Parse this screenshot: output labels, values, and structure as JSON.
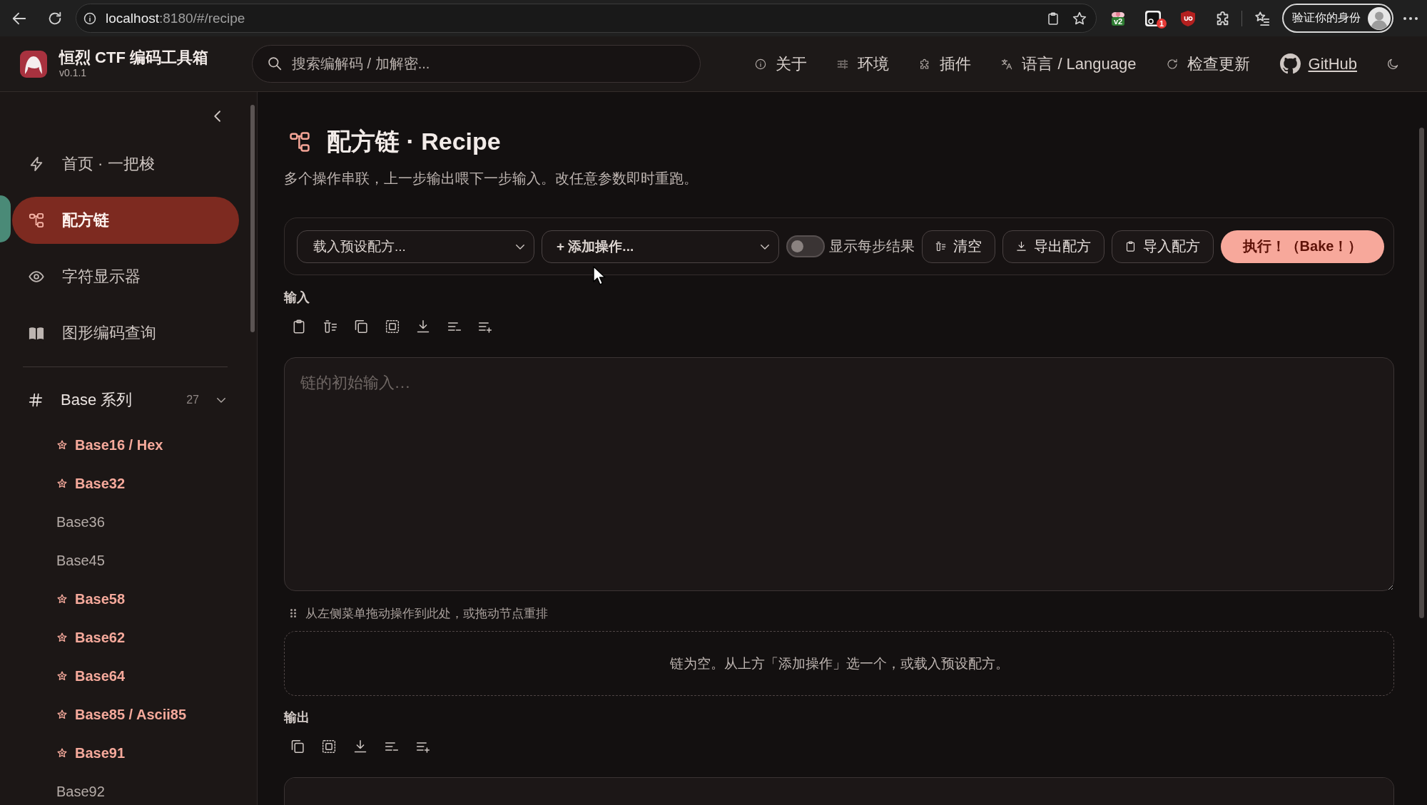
{
  "browser": {
    "url": {
      "host": "localhost",
      "path": ":8180/#/recipe"
    },
    "extensions": [
      {
        "kind": "label",
        "text": "v2"
      },
      {
        "kind": "badge",
        "text": "1"
      },
      {
        "kind": "shield"
      },
      {
        "kind": "puzzle"
      }
    ],
    "profile_button": "验证你的身份"
  },
  "header": {
    "title": "恒烈 CTF 编码工具箱",
    "version": "v0.1.1",
    "search": {
      "placeholder": "搜索编解码 / 加解密..."
    },
    "nav": [
      {
        "kind": "button",
        "label": "关于"
      },
      {
        "kind": "button",
        "label": "环境"
      },
      {
        "kind": "button",
        "label": "插件"
      },
      {
        "kind": "button",
        "label": "语言 / Language"
      },
      {
        "kind": "button",
        "label": "检查更新"
      },
      {
        "kind": "link",
        "label": "GitHub"
      }
    ]
  },
  "sidebar": {
    "nav": [
      {
        "label": "首页 · 一把梭",
        "selected": false
      },
      {
        "label": "配方链",
        "selected": true
      },
      {
        "label": "字符显示器",
        "selected": false
      },
      {
        "label": "图形编码查询",
        "selected": false
      }
    ],
    "groups": [
      {
        "label": "Base 系列",
        "count": "27",
        "expanded": true,
        "items": [
          {
            "label": "Base16 / Hex",
            "starred": true
          },
          {
            "label": "Base32",
            "starred": true
          },
          {
            "label": "Base36",
            "starred": false
          },
          {
            "label": "Base45",
            "starred": false
          },
          {
            "label": "Base58",
            "starred": true
          },
          {
            "label": "Base62",
            "starred": true
          },
          {
            "label": "Base64",
            "starred": true
          },
          {
            "label": "Base85 / Ascii85",
            "starred": true
          },
          {
            "label": "Base91",
            "starred": true
          },
          {
            "label": "Base92",
            "starred": false
          }
        ]
      }
    ]
  },
  "main": {
    "title": "配方链 · Recipe",
    "subtitle": "多个操作串联，上一步输出喂下一步输入。改任意参数即时重跑。",
    "toolbar": {
      "selects": [
        {
          "kind": "preset",
          "label": "载入预设配方..."
        },
        {
          "kind": "action",
          "label": "+ 添加操作..."
        }
      ],
      "show_steps": {
        "label": "显示每步结果",
        "on": false
      },
      "buttons": [
        {
          "kind": "secondary",
          "label": "清空"
        },
        {
          "kind": "secondary",
          "label": "导出配方"
        },
        {
          "kind": "secondary",
          "label": "导入配方"
        },
        {
          "kind": "primary",
          "label": "执行！（Bake！）"
        }
      ]
    },
    "input": {
      "label": "输入",
      "placeholder": "链的初始输入…"
    },
    "drop_hint": "从左侧菜单拖动操作到此处，或拖动节点重排",
    "chain": {
      "empty_text": "链为空。从上方「添加操作」选一个，或载入预设配方。"
    },
    "output": {
      "label": "输出"
    }
  }
}
